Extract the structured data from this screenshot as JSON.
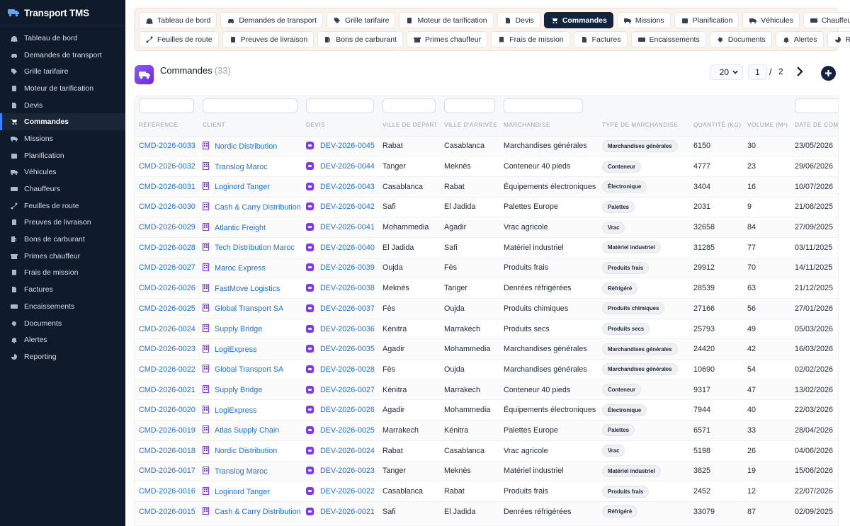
{
  "app": {
    "name": "Transport TMS"
  },
  "sidebar": {
    "items": [
      {
        "label": "Tableau de bord",
        "icon": "dashboard-icon"
      },
      {
        "label": "Demandes de transport",
        "icon": "car-icon"
      },
      {
        "label": "Grille tarifaire",
        "icon": "tag-icon"
      },
      {
        "label": "Moteur de tarification",
        "icon": "calculator-icon"
      },
      {
        "label": "Devis",
        "icon": "file-icon"
      },
      {
        "label": "Commandes",
        "icon": "cart-icon",
        "active": true
      },
      {
        "label": "Missions",
        "icon": "truck-icon"
      },
      {
        "label": "Planification",
        "icon": "calendar-icon"
      },
      {
        "label": "Véhicules",
        "icon": "truck-icon"
      },
      {
        "label": "Chauffeurs",
        "icon": "id-card-icon"
      },
      {
        "label": "Feuilles de route",
        "icon": "route-icon"
      },
      {
        "label": "Preuves de livraison",
        "icon": "clipboard-check-icon"
      },
      {
        "label": "Bons de carburant",
        "icon": "fuel-icon"
      },
      {
        "label": "Primes chauffeur",
        "icon": "gift-icon"
      },
      {
        "label": "Frais de mission",
        "icon": "receipt-icon"
      },
      {
        "label": "Factures",
        "icon": "invoice-icon"
      },
      {
        "label": "Encaissements",
        "icon": "money-icon"
      },
      {
        "label": "Documents",
        "icon": "paperclip-icon"
      },
      {
        "label": "Alertes",
        "icon": "bell-icon"
      },
      {
        "label": "Reporting",
        "icon": "chart-pie-icon"
      }
    ]
  },
  "topnav": {
    "row1": [
      {
        "label": "Tableau de bord",
        "icon": "dashboard-icon"
      },
      {
        "label": "Demandes de transport",
        "icon": "car-icon"
      },
      {
        "label": "Grille tarifaire",
        "icon": "tag-icon"
      },
      {
        "label": "Moteur de tarification",
        "icon": "calculator-icon"
      },
      {
        "label": "Devis",
        "icon": "file-icon"
      },
      {
        "label": "Commandes",
        "icon": "cart-icon",
        "active": true
      },
      {
        "label": "Missions",
        "icon": "truck-icon"
      },
      {
        "label": "Planification",
        "icon": "calendar-icon"
      },
      {
        "label": "Véhicules",
        "icon": "truck-icon"
      },
      {
        "label": "Chauffeurs",
        "icon": "id-card-icon"
      }
    ],
    "row2": [
      {
        "label": "Feuilles de route",
        "icon": "route-icon"
      },
      {
        "label": "Preuves de livraison",
        "icon": "clipboard-check-icon"
      },
      {
        "label": "Bons de carburant",
        "icon": "fuel-icon"
      },
      {
        "label": "Primes chauffeur",
        "icon": "gift-icon"
      },
      {
        "label": "Frais de mission",
        "icon": "receipt-icon"
      },
      {
        "label": "Factures",
        "icon": "invoice-icon"
      },
      {
        "label": "Encaissements",
        "icon": "money-icon"
      },
      {
        "label": "Documents",
        "icon": "paperclip-icon"
      },
      {
        "label": "Alertes",
        "icon": "bell-icon"
      },
      {
        "label": "Reporting",
        "icon": "chart-pie-icon"
      }
    ]
  },
  "page": {
    "title": "Commandes",
    "count": "(33)",
    "page_size": "20",
    "current_page": "1",
    "separator": "/",
    "total_pages": "2",
    "accent": "#12233d"
  },
  "table": {
    "columns": [
      "RÉFÉRENCE",
      "CLIENT",
      "DEVIS",
      "VILLE DE DÉPART",
      "VILLE D'ARRIVÉE",
      "MARCHANDISE",
      "TYPE DE MARCHANDISE",
      "QUANTITÉ (KG)",
      "VOLUME (M³)",
      "DATE DE COMMANDE"
    ],
    "rows": [
      {
        "ref": "CMD-2026-0033",
        "client": "Nordic Distribution",
        "devis": "DEV-2026-0045",
        "depart": "Rabat",
        "arrivee": "Casablanca",
        "marchandise": "Marchandises générales",
        "type": "Marchandises générales",
        "quantite": "6150",
        "volume": "30",
        "date": "23/05/2026"
      },
      {
        "ref": "CMD-2026-0032",
        "client": "Translog Maroc",
        "devis": "DEV-2026-0044",
        "depart": "Tanger",
        "arrivee": "Meknès",
        "marchandise": "Conteneur 40 pieds",
        "type": "Conteneur",
        "quantite": "4777",
        "volume": "23",
        "date": "29/06/2026"
      },
      {
        "ref": "CMD-2026-0031",
        "client": "Loginord Tanger",
        "devis": "DEV-2026-0043",
        "depart": "Casablanca",
        "arrivee": "Rabat",
        "marchandise": "Équipements électroniques",
        "type": "Électronique",
        "quantite": "3404",
        "volume": "16",
        "date": "10/07/2026"
      },
      {
        "ref": "CMD-2026-0030",
        "client": "Cash & Carry Distribution",
        "devis": "DEV-2026-0042",
        "depart": "Safi",
        "arrivee": "El Jadida",
        "marchandise": "Palettes Europe",
        "type": "Palettes",
        "quantite": "2031",
        "volume": "9",
        "date": "21/08/2025"
      },
      {
        "ref": "CMD-2026-0029",
        "client": "Atlantic Freight",
        "devis": "DEV-2026-0041",
        "depart": "Mohammedia",
        "arrivee": "Agadir",
        "marchandise": "Vrac agricole",
        "type": "Vrac",
        "quantite": "32658",
        "volume": "84",
        "date": "27/09/2025"
      },
      {
        "ref": "CMD-2026-0028",
        "client": "Tech Distribution Maroc",
        "devis": "DEV-2026-0040",
        "depart": "El Jadida",
        "arrivee": "Safi",
        "marchandise": "Matériel industriel",
        "type": "Matériel industriel",
        "quantite": "31285",
        "volume": "77",
        "date": "03/11/2025"
      },
      {
        "ref": "CMD-2026-0027",
        "client": "Maroc Express",
        "devis": "DEV-2026-0039",
        "depart": "Oujda",
        "arrivee": "Fès",
        "marchandise": "Produits frais",
        "type": "Produits frais",
        "quantite": "29912",
        "volume": "70",
        "date": "14/11/2025"
      },
      {
        "ref": "CMD-2026-0026",
        "client": "FastMove Logistics",
        "devis": "DEV-2026-0038",
        "depart": "Meknès",
        "arrivee": "Tanger",
        "marchandise": "Denrées réfrigérées",
        "type": "Réfrigéré",
        "quantite": "28539",
        "volume": "63",
        "date": "21/12/2025"
      },
      {
        "ref": "CMD-2026-0025",
        "client": "Global Transport SA",
        "devis": "DEV-2026-0037",
        "depart": "Fès",
        "arrivee": "Oujda",
        "marchandise": "Produits chimiques",
        "type": "Produits chimiques",
        "quantite": "27166",
        "volume": "56",
        "date": "27/01/2026"
      },
      {
        "ref": "CMD-2026-0024",
        "client": "Supply Bridge",
        "devis": "DEV-2026-0036",
        "depart": "Kénitra",
        "arrivee": "Marrakech",
        "marchandise": "Produits secs",
        "type": "Produits secs",
        "quantite": "25793",
        "volume": "49",
        "date": "05/03/2026"
      },
      {
        "ref": "CMD-2026-0023",
        "client": "LogiExpress",
        "devis": "DEV-2026-0035",
        "depart": "Agadir",
        "arrivee": "Mohammedia",
        "marchandise": "Marchandises générales",
        "type": "Marchandises générales",
        "quantite": "24420",
        "volume": "42",
        "date": "16/03/2026"
      },
      {
        "ref": "CMD-2026-0022",
        "client": "Global Transport SA",
        "devis": "DEV-2026-0028",
        "depart": "Fès",
        "arrivee": "Oujda",
        "marchandise": "Marchandises générales",
        "type": "Marchandises générales",
        "quantite": "10690",
        "volume": "54",
        "date": "02/02/2026"
      },
      {
        "ref": "CMD-2026-0021",
        "client": "Supply Bridge",
        "devis": "DEV-2026-0027",
        "depart": "Kénitra",
        "arrivee": "Marrakech",
        "marchandise": "Conteneur 40 pieds",
        "type": "Conteneur",
        "quantite": "9317",
        "volume": "47",
        "date": "13/02/2026"
      },
      {
        "ref": "CMD-2026-0020",
        "client": "LogiExpress",
        "devis": "DEV-2026-0026",
        "depart": "Agadir",
        "arrivee": "Mohammedia",
        "marchandise": "Équipements électroniques",
        "type": "Électronique",
        "quantite": "7944",
        "volume": "40",
        "date": "22/03/2026"
      },
      {
        "ref": "CMD-2026-0019",
        "client": "Atlas Supply Chain",
        "devis": "DEV-2026-0025",
        "depart": "Marrakech",
        "arrivee": "Kénitra",
        "marchandise": "Palettes Europe",
        "type": "Palettes",
        "quantite": "6571",
        "volume": "33",
        "date": "28/04/2026"
      },
      {
        "ref": "CMD-2026-0018",
        "client": "Nordic Distribution",
        "devis": "DEV-2026-0024",
        "depart": "Rabat",
        "arrivee": "Casablanca",
        "marchandise": "Vrac agricole",
        "type": "Vrac",
        "quantite": "5198",
        "volume": "26",
        "date": "04/06/2026"
      },
      {
        "ref": "CMD-2026-0017",
        "client": "Translog Maroc",
        "devis": "DEV-2026-0023",
        "depart": "Tanger",
        "arrivee": "Meknès",
        "marchandise": "Matériel industriel",
        "type": "Matériel industriel",
        "quantite": "3825",
        "volume": "19",
        "date": "15/06/2026"
      },
      {
        "ref": "CMD-2026-0016",
        "client": "Loginord Tanger",
        "devis": "DEV-2026-0022",
        "depart": "Casablanca",
        "arrivee": "Rabat",
        "marchandise": "Produits frais",
        "type": "Produits frais",
        "quantite": "2452",
        "volume": "12",
        "date": "22/07/2026"
      },
      {
        "ref": "CMD-2026-0015",
        "client": "Cash & Carry Distribution",
        "devis": "DEV-2026-0021",
        "depart": "Safi",
        "arrivee": "El Jadida",
        "marchandise": "Denrées réfrigérées",
        "type": "Réfrigéré",
        "quantite": "33079",
        "volume": "87",
        "date": "02/09/2025"
      }
    ]
  }
}
